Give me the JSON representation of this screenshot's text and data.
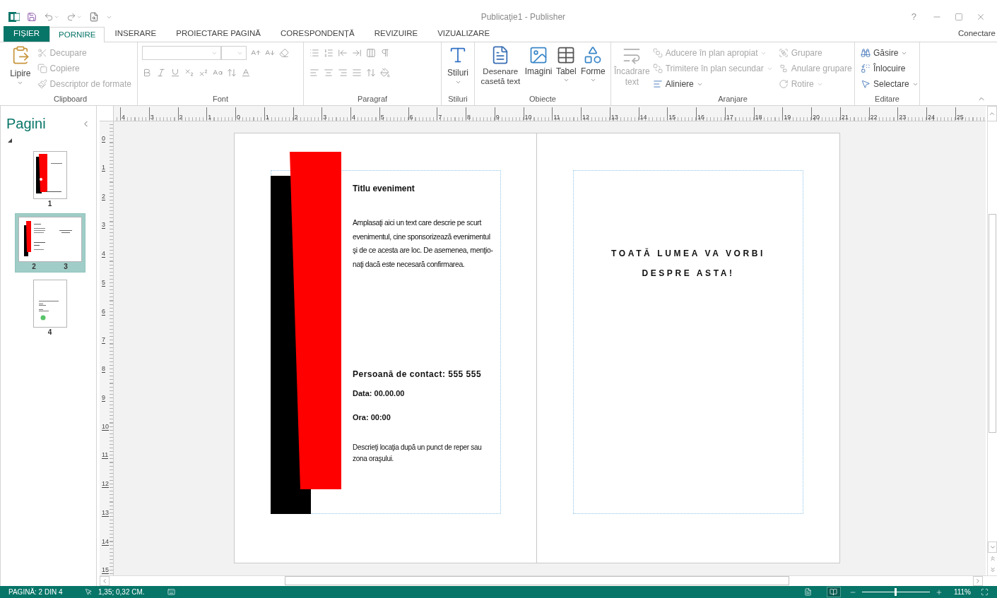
{
  "window": {
    "title": "Publicaţie1 - Publisher",
    "help": "?"
  },
  "tabs": [
    {
      "label": "FIȘIER",
      "kind": "file",
      "selected": false
    },
    {
      "label": "PORNIRE",
      "kind": "tab",
      "selected": true
    },
    {
      "label": "INSERARE",
      "kind": "tab",
      "selected": false
    },
    {
      "label": "PROIECTARE PAGINĂ",
      "kind": "tab",
      "selected": false
    },
    {
      "label": "CORESPONDENȚĂ",
      "kind": "tab",
      "selected": false
    },
    {
      "label": "REVIZUIRE",
      "kind": "tab",
      "selected": false
    },
    {
      "label": "VIZUALIZARE",
      "kind": "tab",
      "selected": false
    }
  ],
  "account": "Conectare",
  "ribbon": {
    "clipboard": {
      "name": "Clipboard",
      "paste": {
        "label": "Lipire",
        "disabled": false
      },
      "cut": {
        "label": "Decupare",
        "disabled": true
      },
      "copy": {
        "label": "Copiere",
        "disabled": true
      },
      "format_painter": {
        "label": "Descriptor de formate",
        "disabled": true
      }
    },
    "font": {
      "name": "Font"
    },
    "paragraph": {
      "name": "Paragraf"
    },
    "styles": {
      "name": "Stiluri",
      "button": "Stiluri"
    },
    "objects": {
      "name": "Obiecte",
      "text_box": "Desenare casetă text",
      "pictures": "Imagini",
      "table": "Tabel",
      "shapes": "Forme"
    },
    "arrange": {
      "name": "Aranjare",
      "wrap": {
        "label": "Încadrare text",
        "disabled": true
      },
      "bring_forward": {
        "label": "Aducere în plan apropiat",
        "disabled": true
      },
      "send_backward": {
        "label": "Trimitere în plan secundar",
        "disabled": true
      },
      "align": {
        "label": "Aliniere",
        "disabled": false
      },
      "group": {
        "label": "Grupare",
        "disabled": true
      },
      "ungroup": {
        "label": "Anulare grupare",
        "disabled": true
      },
      "rotate": {
        "label": "Rotire",
        "disabled": true
      }
    },
    "editing": {
      "name": "Editare",
      "find": {
        "label": "Găsire",
        "disabled": false
      },
      "replace": {
        "label": "Înlocuire",
        "disabled": false
      },
      "select": {
        "label": "Selectare",
        "disabled": false
      }
    }
  },
  "pages_panel": {
    "title": "Pagini",
    "pages": [
      {
        "kind": "cover",
        "numbers": [
          "1"
        ],
        "selected": false
      },
      {
        "kind": "spread",
        "numbers": [
          "2",
          "3"
        ],
        "selected": true
      },
      {
        "kind": "back",
        "numbers": [
          "4"
        ],
        "selected": false
      }
    ]
  },
  "rulers": {
    "horizontal": [
      "4",
      "3",
      "2",
      "1",
      "0",
      "1",
      "2",
      "3",
      "4",
      "5",
      "6",
      "7",
      "8",
      "9",
      "10",
      "11",
      "12",
      "13",
      "14",
      "15",
      "16",
      "17",
      "18",
      "19",
      "20",
      "21",
      "22",
      "23",
      "24",
      "25"
    ],
    "vertical": [
      "0",
      "1",
      "2",
      "3",
      "4",
      "5",
      "6",
      "7",
      "8",
      "9",
      "10",
      "11",
      "12",
      "13",
      "14",
      "15"
    ]
  },
  "document": {
    "left_page": {
      "title": "Titlu eveniment",
      "body_lines": [
        "Amplasaţi aici un text care descrie pe scurt",
        "evenimentul, cine sponsorizează evenimentul",
        "şi de ce acesta are loc. De asemenea, menţio-",
        "naţi dacă este necesară confirmarea."
      ],
      "contact": "Persoană de contact: 555 555",
      "date": "Data: 00.00.00",
      "time": "Ora: 00:00",
      "location_lines": [
        "Descrieţi locaţia după un punct de reper sau",
        "zona oraşului."
      ]
    },
    "right_page": {
      "headline_lines": [
        "TOATĂ LUMEA VA VORBI",
        "DESPRE ASTA!"
      ]
    }
  },
  "status_bar": {
    "page": "PAGINĂ: 2 DIN 4",
    "position": "1,35; 0,32 CM.",
    "views": [
      {
        "kind": "single",
        "selected": false
      },
      {
        "kind": "two-page",
        "selected": true
      }
    ],
    "zoom_slider": {
      "level": 0.5
    },
    "zoom": "111%"
  }
}
